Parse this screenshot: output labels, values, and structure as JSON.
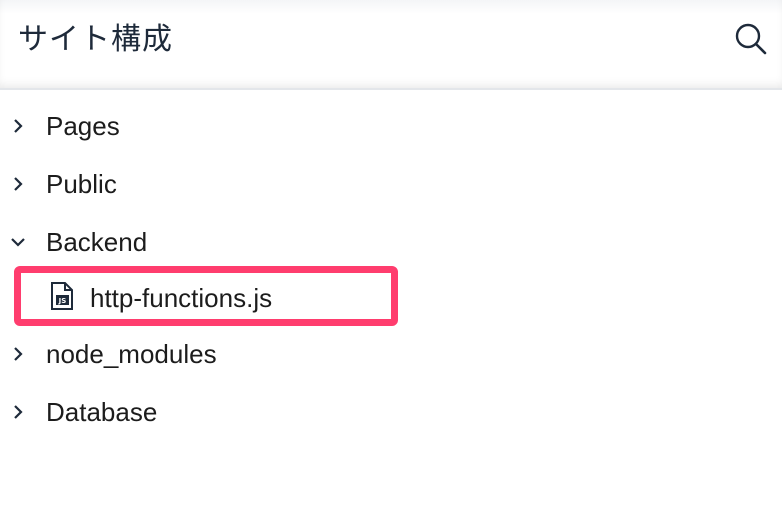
{
  "header": {
    "title": "サイト構成",
    "search_icon": "search-icon"
  },
  "tree": {
    "items": [
      {
        "label": "Pages",
        "expanded": false,
        "icon": "chevron-right-icon"
      },
      {
        "label": "Public",
        "expanded": false,
        "icon": "chevron-right-icon"
      },
      {
        "label": "Backend",
        "expanded": true,
        "icon": "chevron-down-icon",
        "children": [
          {
            "label": "http-functions.js",
            "icon": "js-file-icon",
            "highlighted": true
          }
        ]
      },
      {
        "label": "node_modules",
        "expanded": false,
        "icon": "chevron-right-icon"
      },
      {
        "label": "Database",
        "expanded": false,
        "icon": "chevron-right-icon"
      }
    ]
  },
  "colors": {
    "highlight": "#ff3d6e",
    "text": "#1c1c1c",
    "divider": "#e3e6ea"
  }
}
